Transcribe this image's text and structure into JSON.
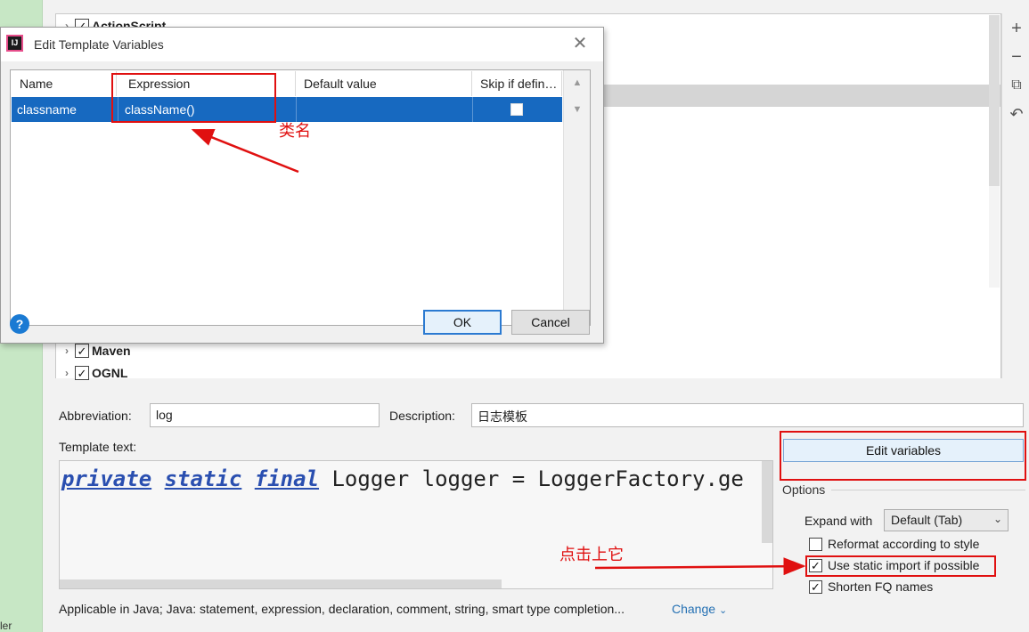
{
  "tree": {
    "items": [
      {
        "label": "ActionScript",
        "checked": true
      },
      {
        "label": "Maven",
        "checked": true
      },
      {
        "label": "OGNL",
        "checked": true
      }
    ]
  },
  "toolbar": {
    "add_icon": "plus-icon",
    "remove_icon": "minus-icon",
    "copy_icon": "copy-icon",
    "restore_icon": "undo-icon"
  },
  "dialog": {
    "title": "Edit Template Variables",
    "columns": [
      "Name",
      "Expression",
      "Default value",
      "Skip if defin…"
    ],
    "rows": [
      {
        "name": "classname",
        "expression": "className()",
        "default_value": "",
        "skip_if_defined": false
      }
    ],
    "ok_label": "OK",
    "cancel_label": "Cancel",
    "help_label": "?"
  },
  "form": {
    "abbreviation_label": "Abbreviation:",
    "abbreviation_value": "log",
    "description_label": "Description:",
    "description_value": "日志模板",
    "template_label": "Template text:",
    "template_code": {
      "kw1": "private",
      "kw2": "static",
      "kw3": "final",
      "rest": "Logger logger = LoggerFactory.ge"
    },
    "edit_variables_label": "Edit variables",
    "options_title": "Options",
    "expand_with_label": "Expand with",
    "expand_with_value": "Default (Tab)",
    "options": [
      {
        "label": "Reformat according to style",
        "checked": false
      },
      {
        "label": "Use static import if possible",
        "checked": true
      },
      {
        "label": "Shorten FQ names",
        "checked": true
      }
    ],
    "applicable_text": "Applicable in Java; Java: statement, expression, declaration, comment, string, smart type completion...",
    "change_label": "Change"
  },
  "annotations": {
    "class_name_note": "类名",
    "click_note": "点击上它"
  },
  "left_strip_text": "ler",
  "colors": {
    "selection_blue": "#1769c0",
    "annotation_red": "#e01010",
    "keyword_blue": "#2a4fb0"
  }
}
